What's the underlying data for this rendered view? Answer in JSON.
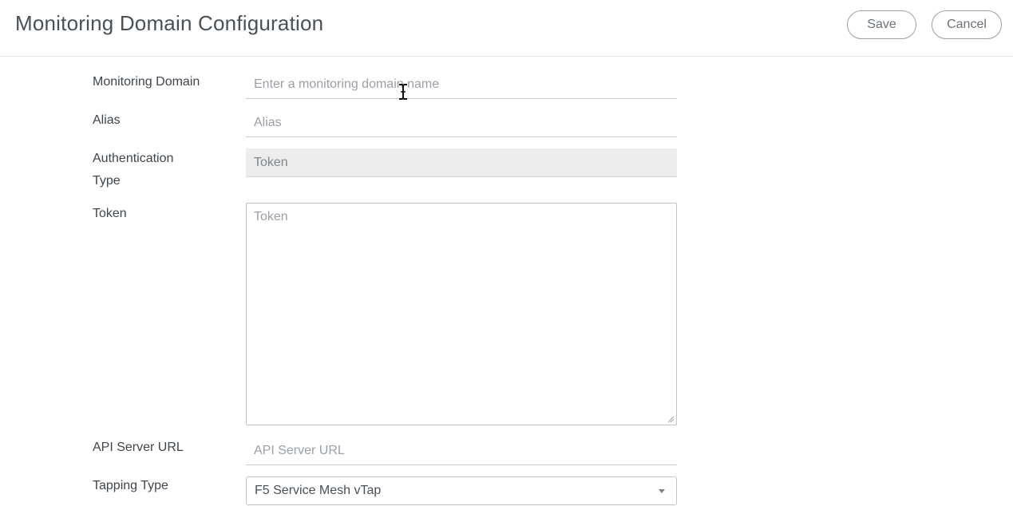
{
  "header": {
    "title": "Monitoring Domain Configuration",
    "save_label": "Save",
    "cancel_label": "Cancel"
  },
  "form": {
    "monitoring_domain": {
      "label": "Monitoring Domain",
      "placeholder": "Enter a monitoring domain name",
      "value": ""
    },
    "alias": {
      "label": "Alias",
      "placeholder": "Alias",
      "value": ""
    },
    "authentication_type": {
      "label_line1": "Authentication",
      "label_line2": "Type",
      "value": "Token"
    },
    "token": {
      "label": "Token",
      "placeholder": "Token",
      "value": ""
    },
    "api_server_url": {
      "label": "API Server URL",
      "placeholder": "API Server URL",
      "value": ""
    },
    "tapping_type": {
      "label": "Tapping Type",
      "selected": "F5 Service Mesh vTap"
    }
  },
  "icons": {
    "text_cursor": "text-cursor-icon",
    "dropdown": "chevron-down-icon",
    "resize": "resize-grip-icon"
  }
}
